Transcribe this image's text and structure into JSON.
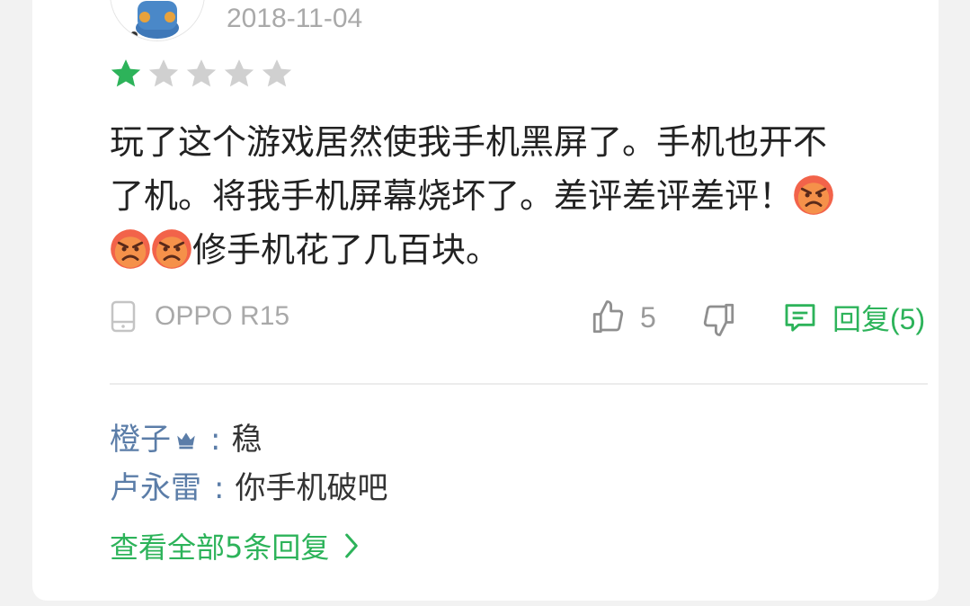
{
  "review": {
    "date": "2018-11-04",
    "rating": 1,
    "max_rating": 5,
    "text_line1": "玩了这个游戏居然使我手机黑屏了。手机也开不",
    "text_line2": "了机。将我手机屏幕烧坏了。差评差评差评！",
    "text_line3": "修手机花了几百块。",
    "device": "OPPO R15",
    "like_count": "5",
    "reply_label": "回复(5)"
  },
  "replies": [
    {
      "user": "橙子",
      "sep": ":",
      "text": "稳"
    },
    {
      "user": "卢永雷",
      "sep": ":",
      "text": "你手机破吧"
    }
  ],
  "view_all_label": "查看全部5条回复",
  "colors": {
    "accent_green": "#2db35a",
    "star_active": "#2db35a",
    "star_inactive": "#d0d0d0",
    "username_blue": "#5b7da8"
  },
  "icons": [
    "avatar",
    "star-icon",
    "angry-face-emoji",
    "phone-icon",
    "thumbs-up-icon",
    "thumbs-down-icon",
    "comment-icon",
    "crown-icon",
    "chevron-right-icon"
  ]
}
